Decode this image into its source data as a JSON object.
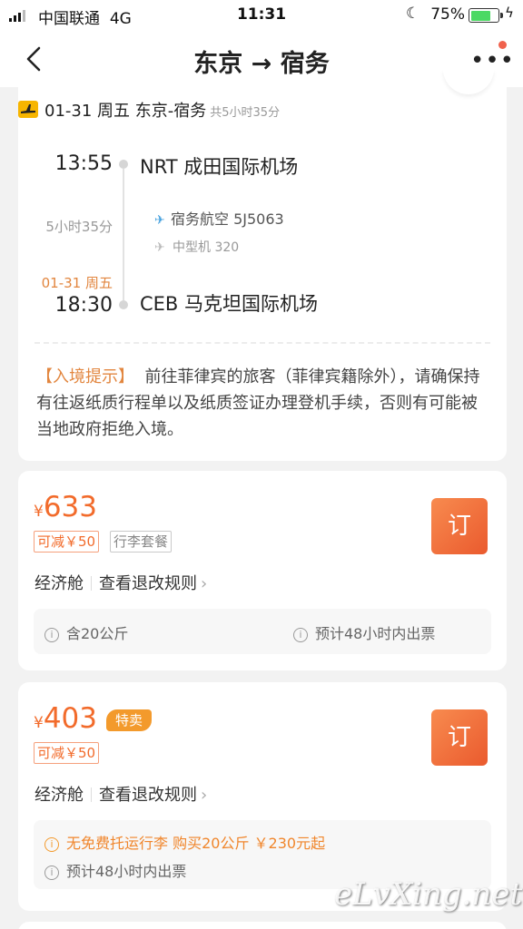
{
  "status_bar": {
    "carrier": "中国联通",
    "network": "4G",
    "time": "11:31",
    "battery": "75%",
    "battery_level": 0.75
  },
  "nav": {
    "title": "东京 → 宿务"
  },
  "flight": {
    "header": "01-31 周五 东京-宿务",
    "total_duration": "共5小时35分",
    "dep_time": "13:55",
    "dep_airport": "NRT 成田国际机场",
    "duration": "5小时35分",
    "airline": "宿务航空 5J5063",
    "aircraft": "中型机 320",
    "arr_date": "01-31 周五",
    "arr_time": "18:30",
    "arr_airport": "CEB 马克坦国际机场",
    "notice_tag": "【入境提示】",
    "notice_text": "前往菲律宾的旅客（菲律宾籍除外），请确保持有往返纸质行程单以及纸质签证办理登机手续，否则有可能被当地政府拒绝入境。"
  },
  "offers": [
    {
      "currency": "¥",
      "price": "633",
      "discount": "可减￥50",
      "package": "行李套餐",
      "cabin": "经济舱",
      "rule_link": "查看退改规则",
      "book": "订",
      "baggage": "含20公斤",
      "ticketing": "预计48小时内出票"
    },
    {
      "currency": "¥",
      "price": "403",
      "badge": "特卖",
      "discount": "可减￥50",
      "cabin": "经济舱",
      "rule_link": "查看退改规则",
      "book": "订",
      "baggage_notice": "无免费托运行李 购买20公斤 ￥230元起",
      "ticketing": "预计48小时内出票"
    }
  ],
  "watermark": "eLvXing.net",
  "colors": {
    "accent": "#f26b2b",
    "sale": "#f39a2c",
    "airline_badge": "#f7b500",
    "battery": "#4cd964"
  }
}
